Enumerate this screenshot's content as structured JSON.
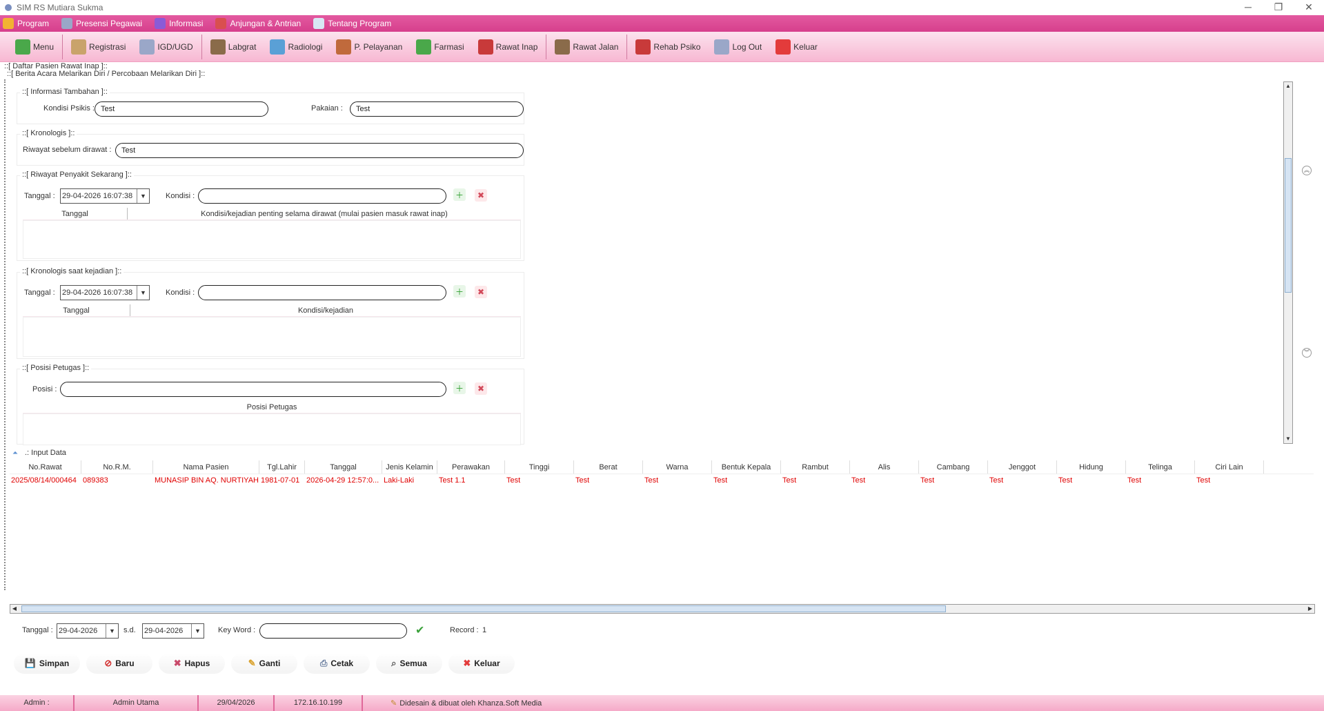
{
  "window": {
    "title": "SIM RS  Mutiara Sukma",
    "buttons": [
      "─",
      "❐",
      "✕"
    ]
  },
  "menubar": [
    {
      "label": "Program",
      "icon": "key-icon",
      "color": "#f2b233"
    },
    {
      "label": "Presensi Pegawai",
      "icon": "user-icon",
      "color": "#9aa7c8"
    },
    {
      "label": "Informasi",
      "icon": "chart-icon",
      "color": "#8a5bd6"
    },
    {
      "label": "Anjungan & Antrian",
      "icon": "kiosk-icon",
      "color": "#d94f4f"
    },
    {
      "label": "Tentang Program",
      "icon": "notepad-icon",
      "color": "#d8e8f4"
    }
  ],
  "toolbar": [
    {
      "label": "Menu",
      "icon": "home-icon",
      "color": "#4aa84a"
    },
    {
      "label": "Registrasi",
      "icon": "registration-icon",
      "color": "#c9a36b"
    },
    {
      "label": "IGD/UGD",
      "icon": "ambulance-icon",
      "color": "#9aa7c8"
    },
    {
      "label": "Labgrat",
      "icon": "lab-icon",
      "color": "#8a6b4a"
    },
    {
      "label": "Radiologi",
      "icon": "radiology-icon",
      "color": "#5aa0d6"
    },
    {
      "label": "P. Pelayanan",
      "icon": "staff-icon",
      "color": "#c06a3c"
    },
    {
      "label": "Farmasi",
      "icon": "pharmacy-icon",
      "color": "#4aa84a"
    },
    {
      "label": "Rawat Inap",
      "icon": "inpatient-icon",
      "color": "#c83a3a"
    },
    {
      "label": "Rawat Jalan",
      "icon": "outpatient-icon",
      "color": "#8a6b4a"
    },
    {
      "label": "Rehab Psiko",
      "icon": "rehab-icon",
      "color": "#c83a3a"
    },
    {
      "label": "Log Out",
      "icon": "logout-icon",
      "color": "#9aa7c8"
    },
    {
      "label": "Keluar",
      "icon": "exit-icon",
      "color": "#e33b3b"
    }
  ],
  "outer_label": "::[ Daftar Pasien Rawat Inap ]::",
  "inner_label": "::[ Berita Acara Melarikan Diri / Percobaan Melarikan Diri ]::",
  "info_tambahan": {
    "title": "::[ Informasi Tambahan ]::",
    "kondisi_psikis_label": "Kondisi Psikis :",
    "kondisi_psikis_value": "Test",
    "pakaian_label": "Pakaian :",
    "pakaian_value": "Test"
  },
  "kronologis": {
    "title": "::[ Kronologis ]::",
    "riwayat_label": "Riwayat sebelum dirawat :",
    "riwayat_value": "Test"
  },
  "riwayat_penyakit": {
    "title": "::[ Riwayat Penyakit Sekarang ]::",
    "tanggal_label": "Tanggal :",
    "tanggal_value": "29-04-2026 16:07:38",
    "kondisi_label": "Kondisi :",
    "kondisi_value": "",
    "col_tanggal": "Tanggal",
    "col_kondisi": "Kondisi/kejadian penting selama dirawat (mulai pasien masuk rawat inap)"
  },
  "kronologis_kejadian": {
    "title": "::[ Kronologis saat kejadian ]::",
    "tanggal_label": "Tanggal :",
    "tanggal_value": "29-04-2026 16:07:38",
    "kondisi_label": "Kondisi :",
    "kondisi_value": "",
    "col_tanggal": "Tanggal",
    "col_kondisi": "Kondisi/kejadian"
  },
  "posisi_petugas": {
    "title": "::[ Posisi Petugas ]::",
    "posisi_label": "Posisi :",
    "posisi_value": "",
    "col_posisi": "Posisi Petugas"
  },
  "input_data_label": ".: Input Data",
  "grid": {
    "columns": [
      "No.Rawat",
      "No.R.M.",
      "Nama Pasien",
      "Tgl.Lahir",
      "Tanggal",
      "Jenis Kelamin",
      "Perawakan",
      "Tinggi",
      "Berat",
      "Warna",
      "Bentuk Kepala",
      "Rambut",
      "Alis",
      "Cambang",
      "Jenggot",
      "Hidung",
      "Telinga",
      "Ciri Lain"
    ],
    "rows": [
      [
        "2025/08/14/000464",
        "089383",
        "MUNASIP BIN AQ. NURTIYAH",
        "1981-07-01",
        "2026-04-29 12:57:0...",
        "Laki-Laki",
        "Test 1.1",
        "Test",
        "Test",
        "Test",
        "Test",
        "Test",
        "Test",
        "Test",
        "Test",
        "Test",
        "Test",
        "Test"
      ]
    ]
  },
  "filter": {
    "tanggal_label": "Tanggal :",
    "tanggal_from": "29-04-2026",
    "sd_label": "s.d.",
    "tanggal_to": "29-04-2026",
    "keyword_label": "Key Word :",
    "keyword_value": "",
    "record_label": "Record :",
    "record_value": "1"
  },
  "buttons": [
    {
      "label": "Simpan",
      "icon": "save-icon",
      "glyph": "💾",
      "color": "#2d6fc0"
    },
    {
      "label": "Baru",
      "icon": "new-icon",
      "glyph": "⊘",
      "color": "#d32f2f"
    },
    {
      "label": "Hapus",
      "icon": "delete-icon",
      "glyph": "✖",
      "color": "#c94a6a"
    },
    {
      "label": "Ganti",
      "icon": "edit-icon",
      "glyph": "✎",
      "color": "#d9a22f"
    },
    {
      "label": "Cetak",
      "icon": "print-icon",
      "glyph": "⎙",
      "color": "#6b7fa0"
    },
    {
      "label": "Semua",
      "icon": "search-icon",
      "glyph": "⌕",
      "color": "#555"
    },
    {
      "label": "Keluar",
      "icon": "exit-icon",
      "glyph": "✖",
      "color": "#e33b3b"
    }
  ],
  "statusbar": {
    "user": "Admin :",
    "role": "Admin Utama",
    "date": "29/04/2026",
    "ip": "172.16.10.199",
    "credit": "Didesain & dibuat oleh Khanza.Soft Media"
  }
}
